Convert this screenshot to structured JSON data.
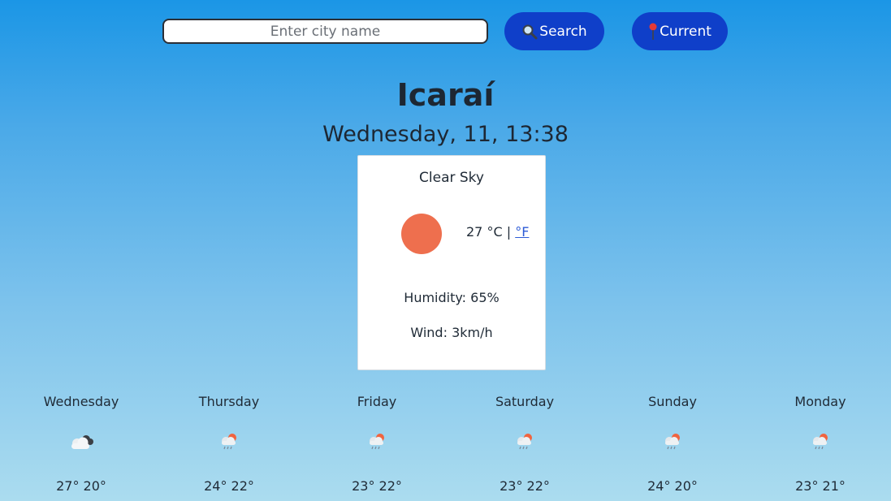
{
  "search": {
    "placeholder": "Enter city name",
    "search_label": "Search",
    "current_label": "Current"
  },
  "location": {
    "city": "Icaraí",
    "datetime": "Wednesday, 11, 13:38"
  },
  "current": {
    "description": "Clear Sky",
    "icon": "clear-sky-sun-icon",
    "temperature": "27",
    "unit_c": "°C",
    "separator": "|",
    "unit_f": "°F",
    "humidity": "Humidity: 65%",
    "wind": "Wind: 3km/h"
  },
  "forecast": [
    {
      "day": "Wednesday",
      "icon": "cloudy-icon",
      "temps": "27° 20°"
    },
    {
      "day": "Thursday",
      "icon": "rain-sun-icon",
      "temps": "24° 22°"
    },
    {
      "day": "Friday",
      "icon": "rain-sun-icon",
      "temps": "23° 22°"
    },
    {
      "day": "Saturday",
      "icon": "rain-sun-icon",
      "temps": "23° 22°"
    },
    {
      "day": "Sunday",
      "icon": "rain-sun-icon",
      "temps": "24° 20°"
    },
    {
      "day": "Monday",
      "icon": "rain-sun-icon",
      "temps": "23° 21°"
    }
  ],
  "colors": {
    "button": "#0f3fc9",
    "sun": "#ee6f4e",
    "link": "#2d5bd6"
  }
}
